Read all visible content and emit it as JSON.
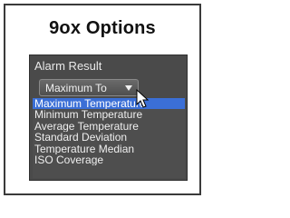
{
  "dialog": {
    "title": "9ox Options"
  },
  "panel": {
    "label": "Alarm Result",
    "select": {
      "value": "Maximum To"
    },
    "options": [
      {
        "label": "Maximum Temperature",
        "selected": true
      },
      {
        "label": "Minimum Temperature",
        "selected": false
      },
      {
        "label": "Average Temperature",
        "selected": false
      },
      {
        "label": "Standard Deviation",
        "selected": false
      },
      {
        "label": "Temperature Median",
        "selected": false
      },
      {
        "label": "ISO Coverage",
        "selected": false
      }
    ]
  },
  "icons": {
    "dropdown_arrow": "chevron-down-icon",
    "cursor": "mouse-pointer-icon"
  },
  "colors": {
    "highlight": "#3b6fd6",
    "panel_background": "#4a4a4a"
  }
}
